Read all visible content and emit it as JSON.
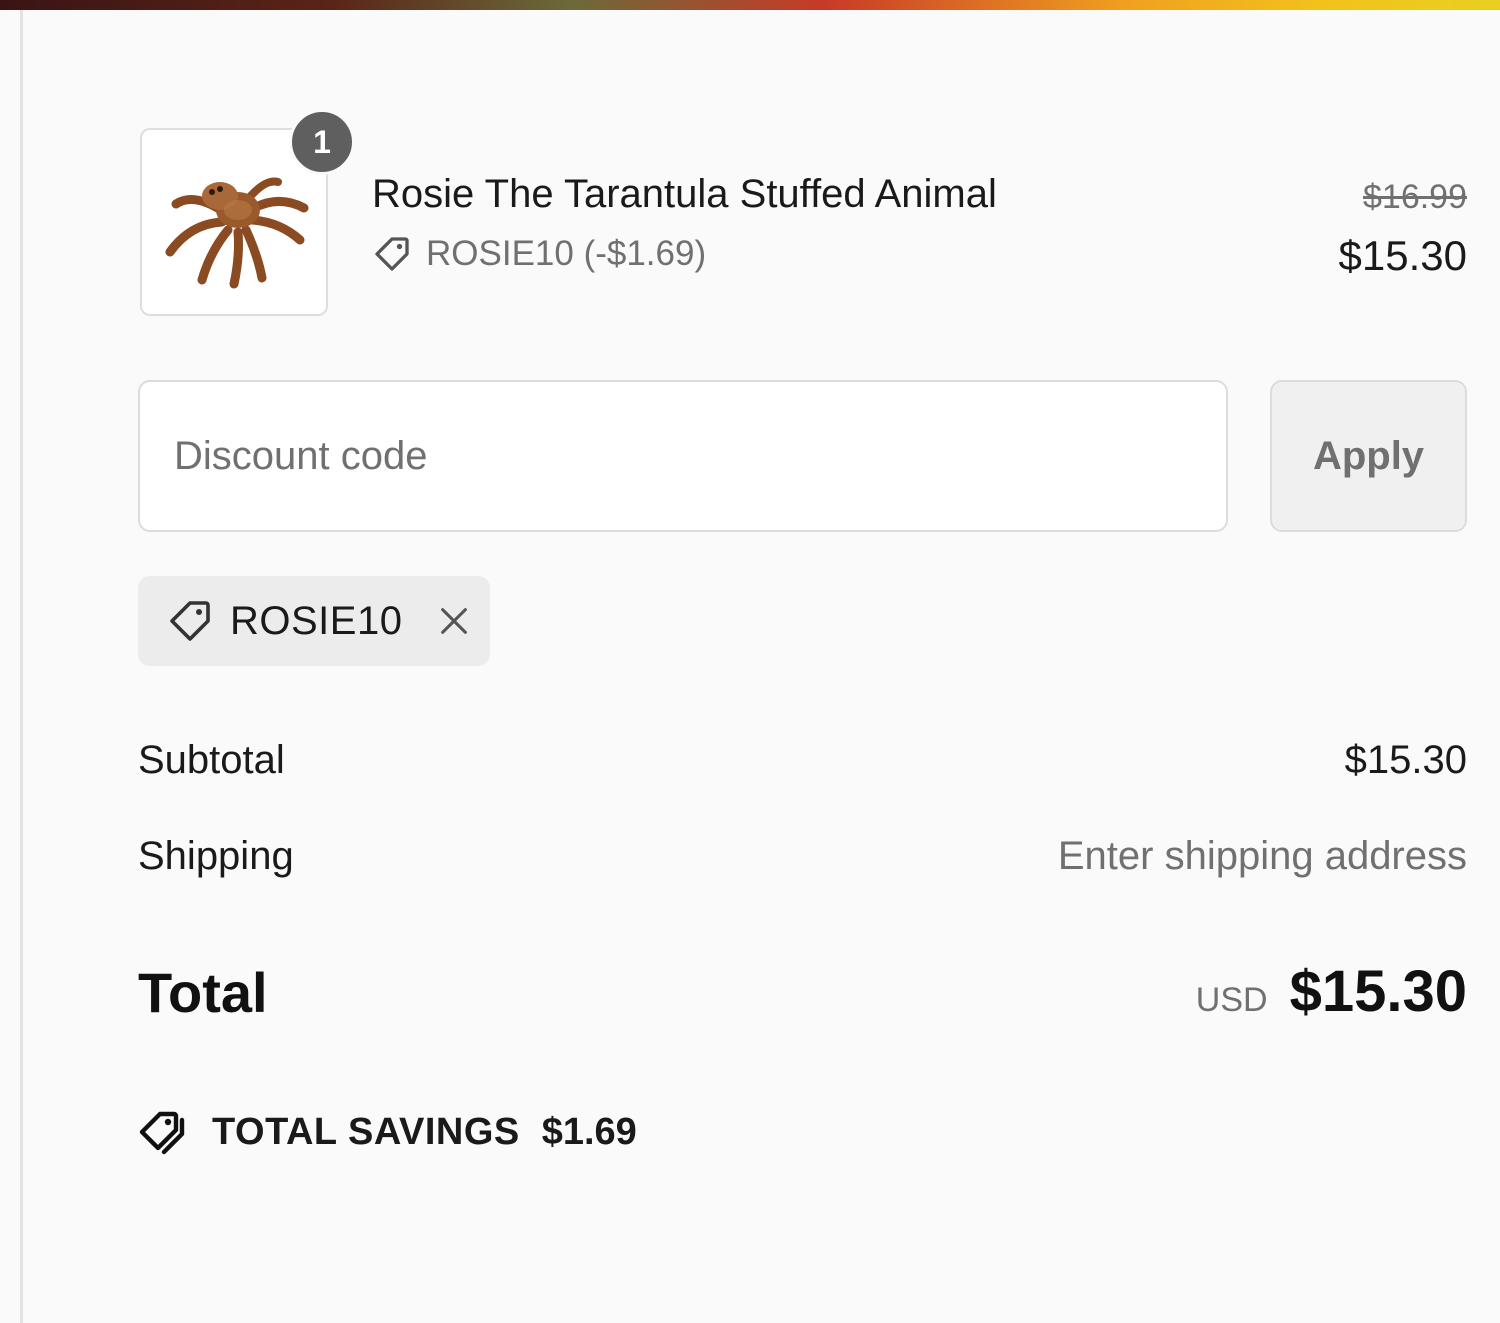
{
  "line_item": {
    "quantity": "1",
    "title": "Rosie The Tarantula Stuffed Animal",
    "discount_text": "ROSIE10 (-$1.69)",
    "original_price": "$16.99",
    "price": "$15.30",
    "image_icon": "tarantula-plush-image"
  },
  "discount_form": {
    "placeholder": "Discount code",
    "apply_label": "Apply"
  },
  "applied_code": {
    "code": "ROSIE10",
    "icon": "tag-icon",
    "remove_icon": "close-icon"
  },
  "totals": {
    "subtotal_label": "Subtotal",
    "subtotal_value": "$15.30",
    "shipping_label": "Shipping",
    "shipping_value": "Enter shipping address",
    "total_label": "Total",
    "currency": "USD",
    "total_value": "$15.30"
  },
  "savings": {
    "label": "TOTAL SAVINGS",
    "amount": "$1.69",
    "icon": "tags-icon"
  },
  "colors": {
    "text": "#1a1a1a",
    "muted": "#707070",
    "badge": "#5f5f5f"
  }
}
